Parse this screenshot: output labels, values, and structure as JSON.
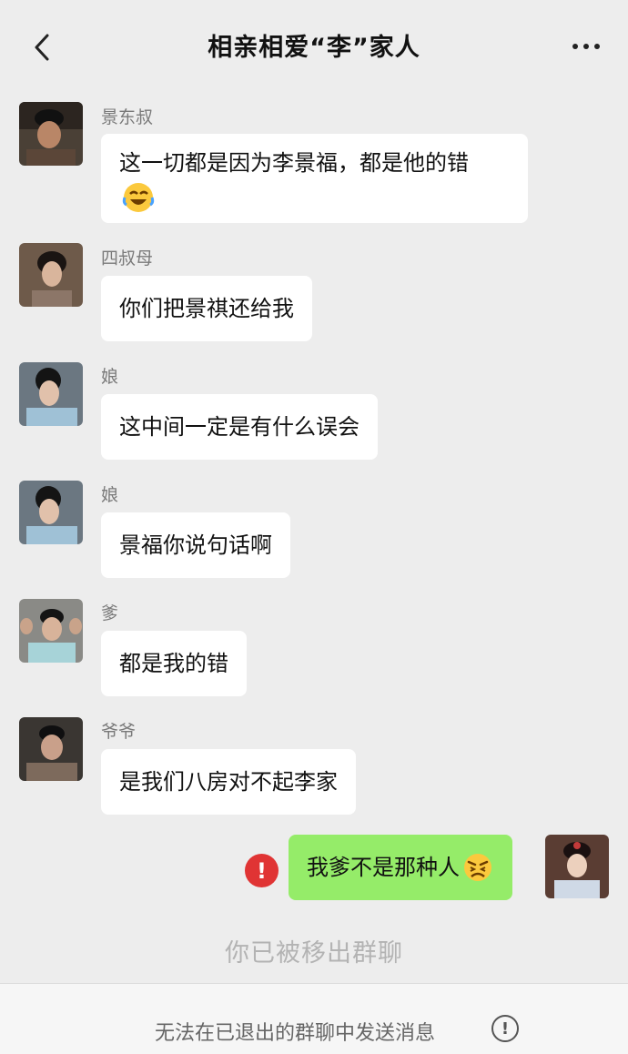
{
  "header": {
    "title": "相亲相爱“李”家人"
  },
  "messages": [
    {
      "sender": "景东叔",
      "text": "这一切都是因为李景福，都是他的错",
      "emoji": "tears-of-joy-laughing"
    },
    {
      "sender": "四叔母",
      "text": "你们把景祺还给我"
    },
    {
      "sender": "娘",
      "text": "这中间一定是有什么误会"
    },
    {
      "sender": "娘",
      "text": "景福你说句话啊"
    },
    {
      "sender": "爹",
      "text": "都是我的错"
    },
    {
      "sender": "爷爷",
      "text": "是我们八房对不起李家"
    }
  ],
  "my_message": {
    "text": "我爹不是那种人",
    "emoji": "angry-face",
    "status": "failed"
  },
  "system_notice": "你已被移出群聊",
  "footer": {
    "text": "无法在已退出的群聊中发送消息"
  },
  "colors": {
    "background": "#ededed",
    "my_bubble": "#95ec69",
    "other_bubble": "#ffffff",
    "error": "#e03434"
  }
}
